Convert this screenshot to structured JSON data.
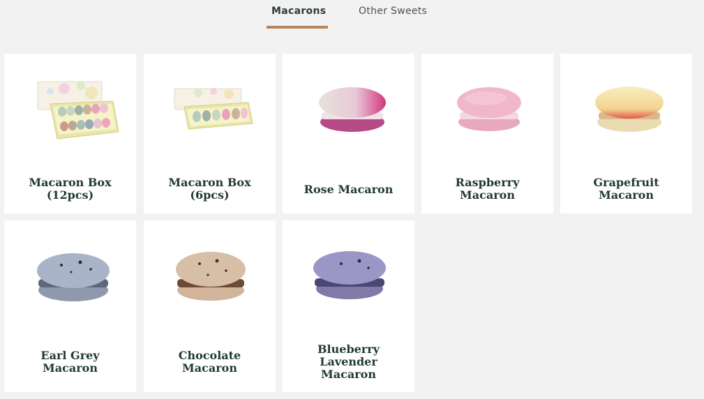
{
  "tabs": {
    "active_label": "Macarons",
    "other_label": "Other Sweets",
    "accent_color": "#b8845a"
  },
  "products": [
    {
      "line1": "Macaron Box",
      "line2": "(12pcs)",
      "line3": "",
      "image": "macaron-box-12-image"
    },
    {
      "line1": "Macaron Box",
      "line2": "(6pcs)",
      "line3": "",
      "image": "macaron-box-6-image"
    },
    {
      "line1": "Rose Macaron",
      "line2": "",
      "line3": "",
      "image": "rose-macaron-image"
    },
    {
      "line1": "Raspberry",
      "line2": "Macaron",
      "line3": "",
      "image": "raspberry-macaron-image"
    },
    {
      "line1": "Grapefruit",
      "line2": "Macaron",
      "line3": "",
      "image": "grapefruit-macaron-image"
    },
    {
      "line1": "Earl Grey",
      "line2": "Macaron",
      "line3": "",
      "image": "earl-grey-macaron-image"
    },
    {
      "line1": "Chocolate",
      "line2": "Macaron",
      "line3": "",
      "image": "chocolate-macaron-image"
    },
    {
      "line1": "Blueberry",
      "line2": "Lavender",
      "line3": "Macaron",
      "image": "blueberry-lavender-macaron-image"
    }
  ]
}
